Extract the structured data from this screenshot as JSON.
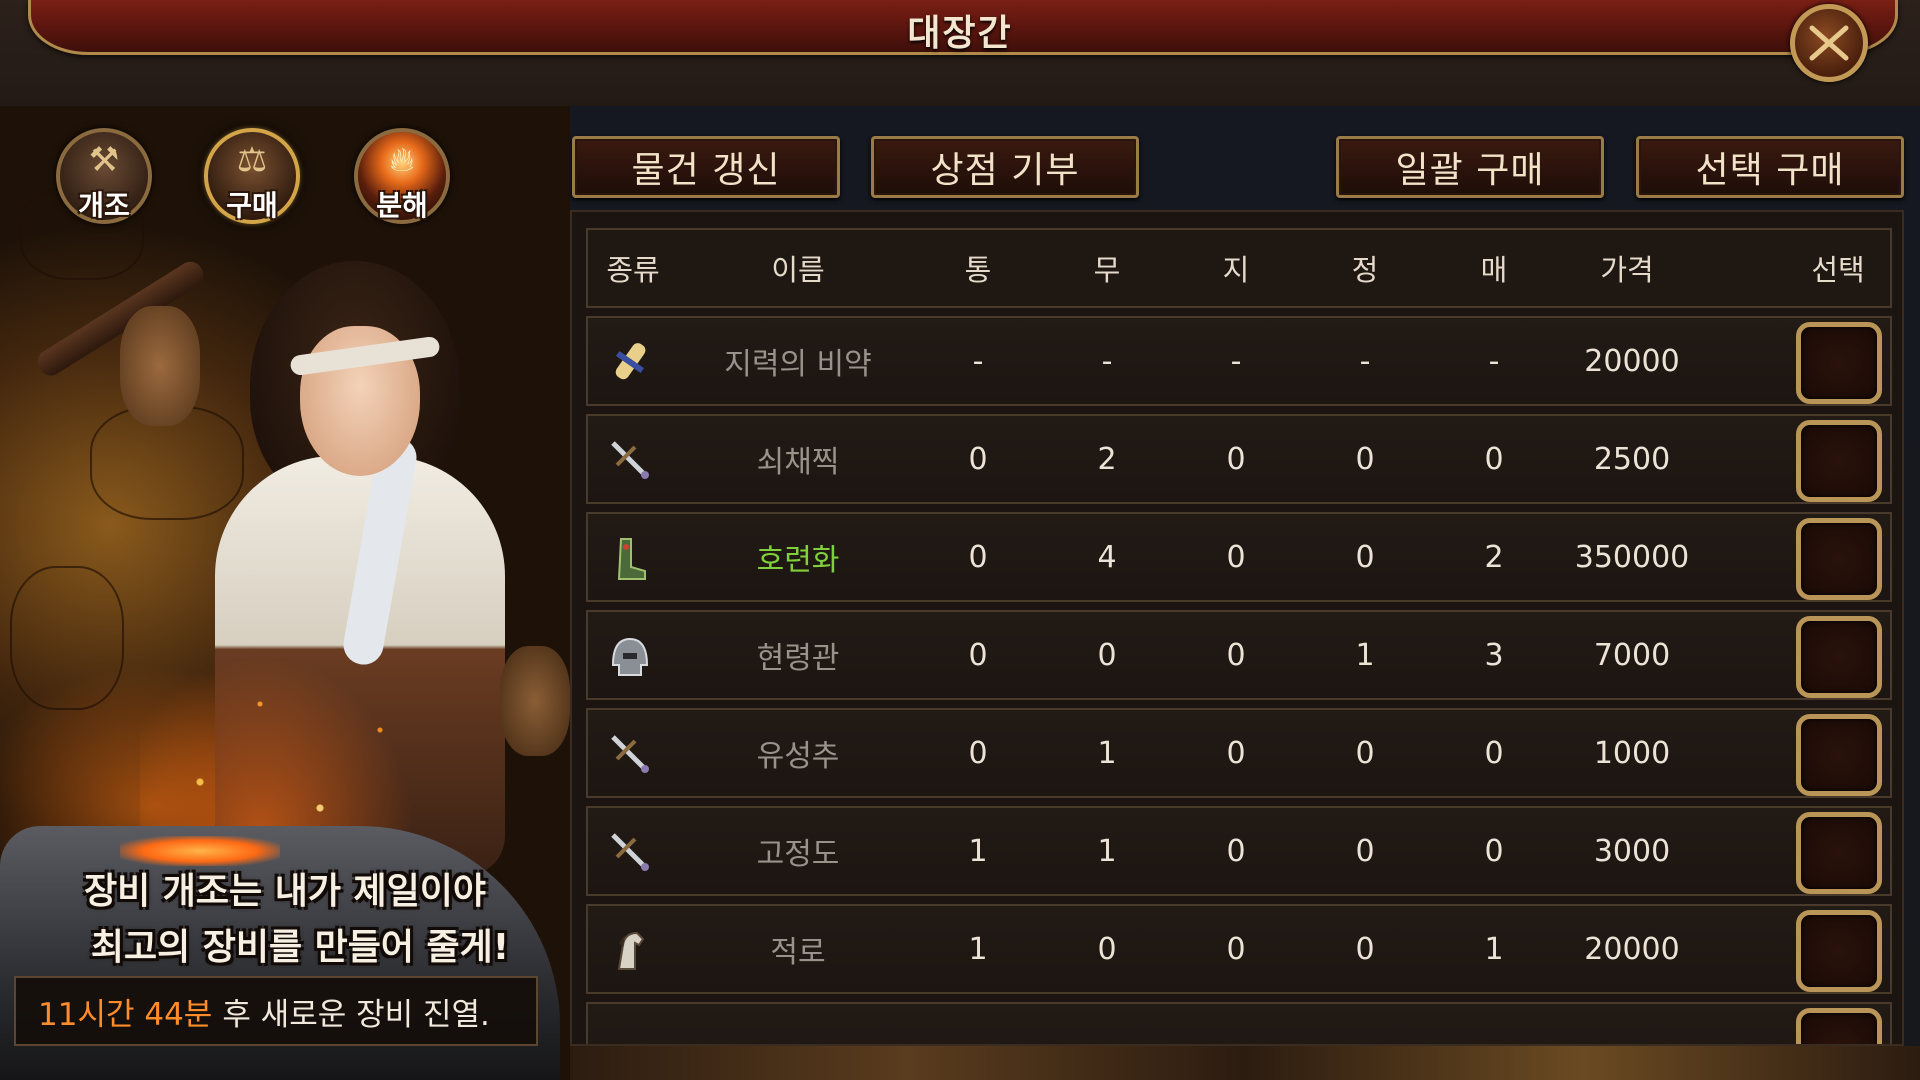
{
  "window": {
    "title": "대장간",
    "close_icon": "close-x-icon"
  },
  "side_menu": [
    {
      "label": "개조",
      "icon": "hammer-icon",
      "active": false
    },
    {
      "label": "구매",
      "icon": "shop-icon",
      "active": true
    },
    {
      "label": "분해",
      "icon": "fire-icon",
      "active": false
    }
  ],
  "slogan": {
    "line1": "장비 개조는 내가 제일이야",
    "line2": "최고의 장비를 만들어 줄게!"
  },
  "timer": {
    "highlight": "11시간 44분",
    "rest": "후 새로운 장비 진열."
  },
  "toolbar": {
    "refresh": "물건 갱신",
    "donate": "상점 기부",
    "buy_all": "일괄 구매",
    "buy_selected": "선택 구매"
  },
  "table": {
    "headers": [
      "종류",
      "이름",
      "통",
      "무",
      "지",
      "정",
      "매",
      "가격",
      "선택"
    ],
    "rows": [
      {
        "icon": "scroll-icon",
        "name": "지력의 비약",
        "tong": "-",
        "mu": "-",
        "ji": "-",
        "jeong": "-",
        "mae": "-",
        "price": "20000",
        "name_color": "gray"
      },
      {
        "icon": "weapon-icon",
        "name": "쇠채찍",
        "tong": "0",
        "mu": "2",
        "ji": "0",
        "jeong": "0",
        "mae": "0",
        "price": "2500",
        "name_color": "gray"
      },
      {
        "icon": "boots-icon",
        "name": "호련화",
        "tong": "0",
        "mu": "4",
        "ji": "0",
        "jeong": "0",
        "mae": "2",
        "price": "350000",
        "name_color": "green"
      },
      {
        "icon": "helmet-icon",
        "name": "현령관",
        "tong": "0",
        "mu": "0",
        "ji": "0",
        "jeong": "1",
        "mae": "3",
        "price": "7000",
        "name_color": "gray"
      },
      {
        "icon": "weapon-icon",
        "name": "유성추",
        "tong": "0",
        "mu": "1",
        "ji": "0",
        "jeong": "0",
        "mae": "0",
        "price": "1000",
        "name_color": "gray"
      },
      {
        "icon": "weapon-icon",
        "name": "고정도",
        "tong": "1",
        "mu": "1",
        "ji": "0",
        "jeong": "0",
        "mae": "0",
        "price": "3000",
        "name_color": "gray"
      },
      {
        "icon": "horse-icon",
        "name": "적로",
        "tong": "1",
        "mu": "0",
        "ji": "0",
        "jeong": "0",
        "mae": "1",
        "price": "20000",
        "name_color": "gray"
      }
    ]
  },
  "colors": {
    "accent_gold": "#b99557",
    "highlight_orange": "#ff8c2a",
    "rare_green": "#7fd03a",
    "title_red": "#7a1f14"
  }
}
